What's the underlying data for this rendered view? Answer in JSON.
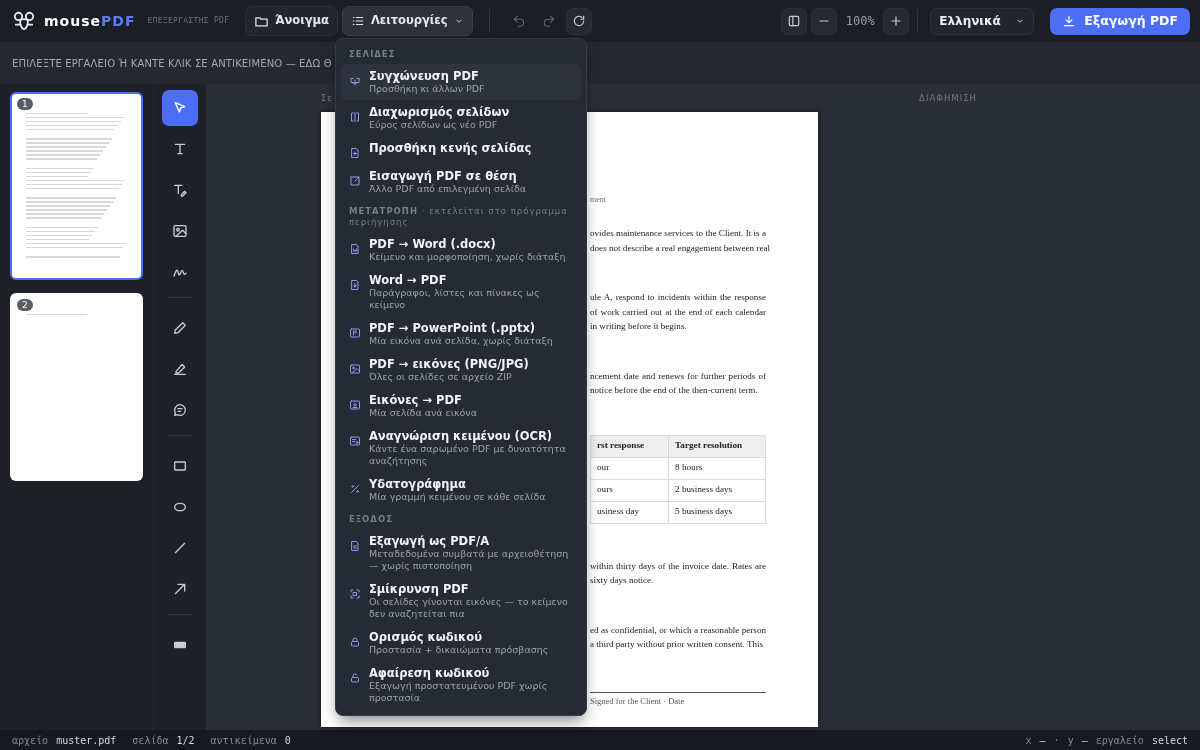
{
  "app": {
    "brand_main": "mouse",
    "brand_accent": "PDF",
    "subtitle": "ΕΠΕΞΕΡΓΑΣΤΗΣ PDF"
  },
  "toolbar": {
    "open_label": "Άνοιγμα",
    "functions_label": "Λειτουργίες",
    "functions_expanded": true,
    "redo_disabled": true,
    "zoom": "100%",
    "language": "Ελληνικά",
    "export_label": "Εξαγωγή PDF"
  },
  "hint": "ΕΠΙΛΕΞΤΕ ΕΡΓΑΛΕΙΟ Ή ΚΑΝΤΕ ΚΛΙΚ ΣΕ ΑΝΤΙΚΕΙΜΕΝΟ — ΕΔΩ Θ",
  "thumbnails": [
    {
      "number": "1",
      "selected": true,
      "kind": "content"
    },
    {
      "number": "2",
      "selected": false,
      "kind": "short"
    }
  ],
  "tools": [
    {
      "kind": "select",
      "selected": true
    },
    {
      "kind": "text",
      "selected": false
    },
    {
      "kind": "textedit",
      "selected": false
    },
    {
      "kind": "image",
      "selected": false
    },
    {
      "kind": "signature",
      "selected": false
    },
    {
      "kind": "divider"
    },
    {
      "kind": "pencil",
      "selected": false
    },
    {
      "kind": "highlighter",
      "selected": false
    },
    {
      "kind": "comment",
      "selected": false
    },
    {
      "kind": "divider"
    },
    {
      "kind": "rect",
      "selected": false
    },
    {
      "kind": "ellipse",
      "selected": false
    },
    {
      "kind": "line",
      "selected": false
    },
    {
      "kind": "arrow",
      "selected": false
    },
    {
      "kind": "divider"
    },
    {
      "kind": "redact",
      "selected": false
    }
  ],
  "canvas": {
    "page_label": "Σε",
    "ad_label": "ΔΙΑΦΗΜΙΣΗ"
  },
  "document": [
    {
      "kind": "meta",
      "text": "ment"
    },
    {
      "kind": "para",
      "lines": [
        "ovides maintenance services to the Client. It is a",
        "does not describe a real engagement between real"
      ]
    },
    {
      "kind": "para",
      "lines": [
        "ule A, respond to incidents within the response",
        "of work carried out at the end of each calendar",
        "in writing before it begins."
      ]
    },
    {
      "kind": "para",
      "lines": [
        "ncement date and renews for further periods of",
        "notice before the end of the then-current term."
      ]
    },
    {
      "kind": "table",
      "header": [
        "rst response",
        "Target resolution"
      ],
      "rows": [
        [
          "our",
          "8 hours"
        ],
        [
          "ours",
          "2 business days"
        ],
        [
          "usiness day",
          "5 business days"
        ]
      ]
    },
    {
      "kind": "para",
      "lines": [
        "within thirty days of the invoice date. Rates are",
        "sixty days notice."
      ]
    },
    {
      "kind": "para",
      "lines": [
        "ed as confidential, or which a reasonable person",
        "a third party without prior written consent. This"
      ]
    },
    {
      "kind": "signature",
      "text": "Signed for the Client · Date"
    }
  ],
  "menu": [
    {
      "heading": "ΣΕΛΙΔΕΣ",
      "items": [
        {
          "title": "Συγχώνευση PDF",
          "subtitle": "Προσθήκη κι άλλων PDF",
          "selected": true
        },
        {
          "title": "Διαχωρισμός σελίδων",
          "subtitle": "Εύρος σελίδων ως νέο PDF",
          "selected": false
        },
        {
          "title": "Προσθήκη κενής σελίδας",
          "selected": false
        },
        {
          "title": "Εισαγωγή PDF σε θέση",
          "subtitle": "Άλλο PDF από επιλεγμένη σελίδα",
          "selected": false
        }
      ]
    },
    {
      "heading": "**ΜΕΤΑΤΡΟΠΗ** · εκτελείται στο πρόγραμμα περιήγησης",
      "items": [
        {
          "title": "PDF → Word (.docx)",
          "subtitle": "Κείμενο και μορφοποίηση, χωρίς διάταξη",
          "selected": false
        },
        {
          "title": "Word → PDF",
          "subtitle": "Παράγραφοι, λίστες και πίνακες ως κείμενο",
          "selected": false
        },
        {
          "title": "PDF → PowerPoint (.pptx)",
          "subtitle": "Μία εικόνα ανά σελίδα, χωρίς διάταξη",
          "selected": false
        },
        {
          "title": "PDF → εικόνες (PNG/JPG)",
          "subtitle": "Όλες οι σελίδες σε αρχείο ZIP",
          "selected": false
        },
        {
          "title": "Εικόνες → PDF",
          "subtitle": "Μία σελίδα ανά εικόνα",
          "selected": false
        },
        {
          "title": "Αναγνώριση κειμένου (OCR)",
          "subtitle": "Κάντε ένα σαρωμένο PDF με δυνατότητα αναζήτησης",
          "selected": false
        },
        {
          "title": "Υδατογράφημα",
          "subtitle": "Μία γραμμή κειμένου σε κάθε σελίδα",
          "selected": false
        }
      ]
    },
    {
      "heading": "ΕΞΟΔΟΣ",
      "items": [
        {
          "title": "Εξαγωγή ως PDF/A",
          "subtitle": "Μεταδεδομένα συμβατά με αρχειοθέτηση — χωρίς πιστοποίηση",
          "selected": false
        },
        {
          "title": "Σμίκρυνση PDF",
          "subtitle": "Οι σελίδες γίνονται εικόνες — το κείμενο δεν αναζητείται πια",
          "selected": false
        },
        {
          "title": "Ορισμός κωδικού",
          "subtitle": "Προστασία + δικαιώματα πρόσβασης",
          "selected": false
        },
        {
          "title": "Αφαίρεση κωδικού",
          "subtitle": "Εξαγωγή προστατευμένου PDF χωρίς προστασία",
          "selected": false
        }
      ]
    }
  ],
  "status_bar": {
    "left": [
      {
        "label": "αρχείο",
        "value": "muster.pdf"
      },
      {
        "label": "σελίδα",
        "value": "1/2"
      },
      {
        "label": "αντικείμενα",
        "value": "0"
      }
    ],
    "right": [
      {
        "label": "x",
        "value": "—"
      },
      {
        "label": "·"
      },
      {
        "label": "y",
        "value": "—"
      },
      {
        "label": "εργαλείο",
        "value": "select"
      }
    ]
  }
}
